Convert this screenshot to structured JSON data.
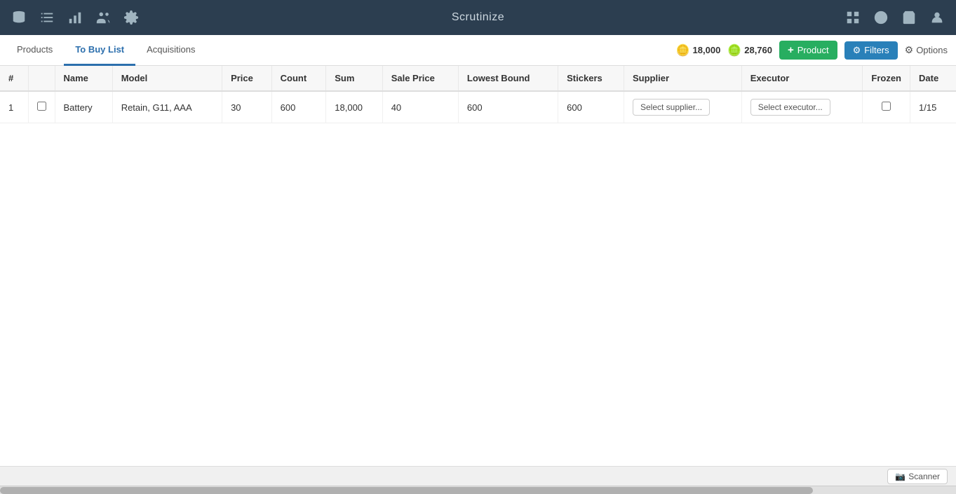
{
  "app": {
    "title": "Scrutinize"
  },
  "navbar": {
    "icons": [
      "database",
      "list",
      "chart",
      "users",
      "settings"
    ],
    "right_icons": [
      "grid",
      "dollar",
      "cart",
      "user"
    ]
  },
  "tabs": [
    {
      "id": "products",
      "label": "Products",
      "active": false
    },
    {
      "id": "tobuylist",
      "label": "To Buy List",
      "active": true
    },
    {
      "id": "acquisitions",
      "label": "Acquisitions",
      "active": false
    }
  ],
  "stats": {
    "coin1_icon": "🪙",
    "coin1_value": "18,000",
    "coin2_icon": "🪙",
    "coin2_value": "28,760"
  },
  "toolbar": {
    "product_label": "Product",
    "filters_label": "Filters",
    "options_label": "Options"
  },
  "table": {
    "columns": [
      "#",
      "",
      "Name",
      "Model",
      "Price",
      "Count",
      "Sum",
      "Sale Price",
      "Lowest Bound",
      "Stickers",
      "Supplier",
      "Executor",
      "Frozen",
      "Date"
    ],
    "rows": [
      {
        "num": "1",
        "checked": false,
        "name": "Battery",
        "model": "Retain, G11, AAA",
        "price": "30",
        "count": "600",
        "sum": "18,000",
        "sale_price": "40",
        "lowest_bound": "600",
        "stickers": "600",
        "supplier": "Select supplier...",
        "executor": "Select executor...",
        "frozen": false,
        "date": "1/15"
      }
    ]
  },
  "bottom": {
    "scanner_label": "Scanner"
  }
}
